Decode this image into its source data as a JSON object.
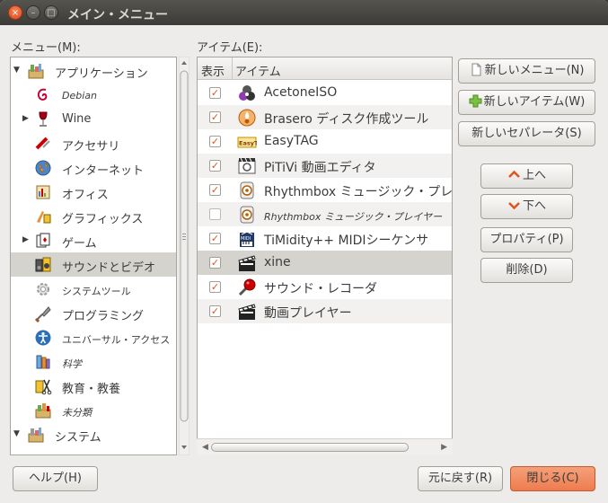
{
  "window": {
    "title": "メイン・メニュー",
    "controls": {
      "close": "×",
      "minimize": "–",
      "maximize": "□"
    }
  },
  "left_pane": {
    "label": "メニュー(M):",
    "items": [
      {
        "label": "アプリケーション",
        "icon": "applications-folder-icon",
        "expander": "▼",
        "level": 0,
        "small": false
      },
      {
        "label": "Debian",
        "icon": "debian-swirl-icon",
        "expander": "",
        "level": 1,
        "small": true
      },
      {
        "label": "Wine",
        "icon": "wine-glass-icon",
        "expander": "▶",
        "level": 1,
        "small": false
      },
      {
        "label": "アクセサリ",
        "icon": "accessories-icon",
        "expander": "",
        "level": 1,
        "small": false
      },
      {
        "label": "インターネット",
        "icon": "globe-icon",
        "expander": "",
        "level": 1,
        "small": false
      },
      {
        "label": "オフィス",
        "icon": "office-icon",
        "expander": "",
        "level": 1,
        "small": false
      },
      {
        "label": "グラフィックス",
        "icon": "graphics-icon",
        "expander": "",
        "level": 1,
        "small": false
      },
      {
        "label": "ゲーム",
        "icon": "cards-icon",
        "expander": "▶",
        "level": 1,
        "small": false
      },
      {
        "label": "サウンドとビデオ",
        "icon": "multimedia-icon",
        "expander": "",
        "level": 1,
        "small": false,
        "selected": true
      },
      {
        "label": "システムツール",
        "icon": "gear-icon",
        "expander": "",
        "level": 1,
        "small": true,
        "plain": true
      },
      {
        "label": "プログラミング",
        "icon": "trowel-icon",
        "expander": "",
        "level": 1,
        "small": false
      },
      {
        "label": "ユニバーサル・アクセス",
        "icon": "accessibility-icon",
        "expander": "",
        "level": 1,
        "small": true,
        "plain": true
      },
      {
        "label": "科学",
        "icon": "science-icon",
        "expander": "",
        "level": 1,
        "small": true
      },
      {
        "label": "教育・教養",
        "icon": "education-icon",
        "expander": "",
        "level": 1,
        "small": false
      },
      {
        "label": "未分類",
        "icon": "other-icon",
        "expander": "",
        "level": 1,
        "small": true
      },
      {
        "label": "システム",
        "icon": "system-folder-icon",
        "expander": "▼",
        "level": 0,
        "small": false
      }
    ]
  },
  "right_pane": {
    "label": "アイテム(E):",
    "columns": {
      "show": "表示",
      "item": "アイテム"
    },
    "items": [
      {
        "label": "AcetoneISO",
        "checked": true,
        "icon": "acetoneiso-icon",
        "dim": false
      },
      {
        "label": "Brasero ディスク作成ツール",
        "checked": true,
        "icon": "brasero-icon",
        "dim": false
      },
      {
        "label": "EasyTAG",
        "checked": true,
        "icon": "easytag-icon",
        "dim": false
      },
      {
        "label": "PiTiVi 動画エディタ",
        "checked": true,
        "icon": "pitivi-icon",
        "dim": false
      },
      {
        "label": "Rhythmbox ミュージック・プレイヤ",
        "checked": true,
        "icon": "rhythmbox-icon",
        "dim": false
      },
      {
        "label": "Rhythmbox ミュージック・プレイヤー",
        "checked": false,
        "icon": "rhythmbox-icon",
        "dim": true
      },
      {
        "label": "TiMidity++ MIDIシーケンサ",
        "checked": true,
        "icon": "timidity-icon",
        "dim": false
      },
      {
        "label": "xine",
        "checked": true,
        "icon": "clapperboard-icon",
        "dim": false,
        "selected": true
      },
      {
        "label": "サウンド・レコーダ",
        "checked": true,
        "icon": "microphone-icon",
        "dim": false
      },
      {
        "label": "動画プレイヤー",
        "checked": true,
        "icon": "clapperboard-icon",
        "dim": false
      }
    ],
    "check_mark": "✓"
  },
  "buttons": {
    "new_menu": "新しいメニュー(N)",
    "new_item": "新しいアイテム(W)",
    "new_separator": "新しいセパレータ(S)",
    "up": "上へ",
    "down": "下へ",
    "properties": "プロパティ(P)",
    "delete": "削除(D)",
    "help": "ヘルプ(H)",
    "revert": "元に戻す(R)",
    "close": "閉じる(C)"
  },
  "colors": {
    "accent": "#ee7c4e",
    "arrow": "#e0541c",
    "titlebar": "#3c3b37"
  }
}
